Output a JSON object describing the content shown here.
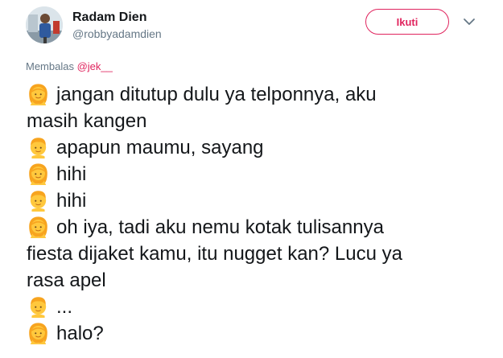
{
  "author": {
    "name": "Radam Dien",
    "handle": "@robbyadamdien"
  },
  "follow_button_label": "Ikuti",
  "reply_to": {
    "prefix": "Membalas",
    "mention": "@jek__"
  },
  "tweet_lines": [
    {
      "emoji": "woman-emoji",
      "text": "jangan ditutup dulu ya telponnya, aku"
    },
    {
      "emoji": "",
      "text": "masih kangen"
    },
    {
      "emoji": "man-emoji",
      "text": "apapun maumu, sayang"
    },
    {
      "emoji": "woman-emoji",
      "text": "hihi"
    },
    {
      "emoji": "man-emoji",
      "text": "hihi"
    },
    {
      "emoji": "woman-emoji",
      "text": "oh iya, tadi aku nemu kotak tulisannya"
    },
    {
      "emoji": "",
      "text": "fiesta dijaket kamu, itu nugget kan? Lucu ya"
    },
    {
      "emoji": "",
      "text": "rasa apel"
    },
    {
      "emoji": "man-emoji",
      "text": "..."
    },
    {
      "emoji": "woman-emoji",
      "text": "halo?"
    }
  ],
  "colors": {
    "accent": "#e0245e",
    "secondary_text": "#657786",
    "primary_text": "#14171a",
    "emoji_skin": "#ffc83d",
    "emoji_hair": "#f7a41f"
  }
}
